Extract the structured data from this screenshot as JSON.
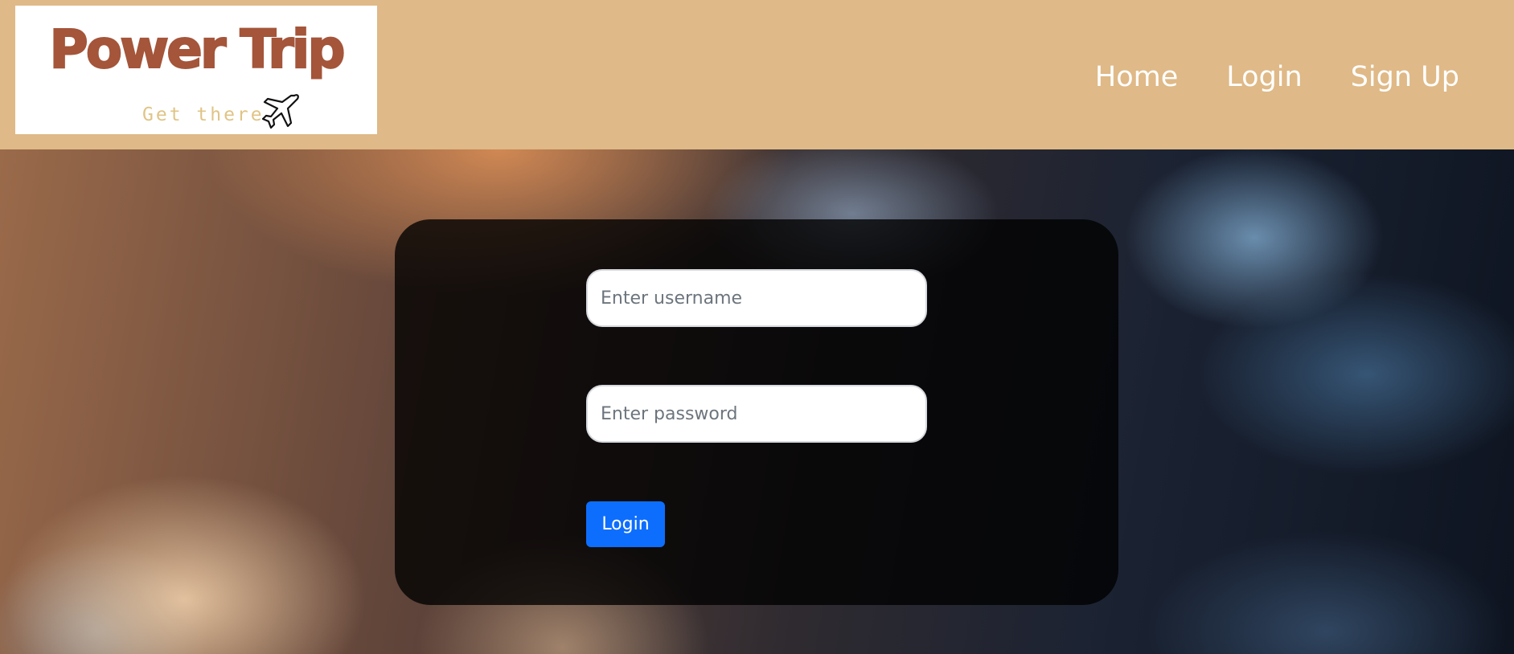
{
  "header": {
    "logo": {
      "title": "Power Trip",
      "tagline": "Get there",
      "icon": "airplane-icon"
    },
    "nav": [
      {
        "label": "Home"
      },
      {
        "label": "Login"
      },
      {
        "label": "Sign Up"
      }
    ]
  },
  "login_form": {
    "username": {
      "value": "",
      "placeholder": "Enter username"
    },
    "password": {
      "value": "",
      "placeholder": "Enter password"
    },
    "submit_label": "Login"
  },
  "colors": {
    "header_bg": "#dfb987",
    "logo_text": "#a4553a",
    "tagline": "#e0c486",
    "button": "#0d6efd"
  }
}
